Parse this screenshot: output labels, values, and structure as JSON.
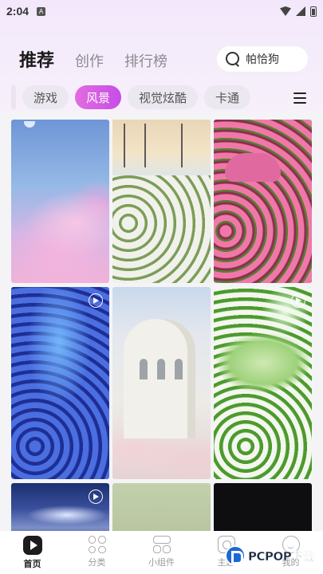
{
  "status_bar": {
    "time": "2:04",
    "notification_badge": "A"
  },
  "top_tabs": [
    {
      "label": "推荐",
      "active": true
    },
    {
      "label": "创作",
      "active": false
    },
    {
      "label": "排行榜",
      "active": false
    }
  ],
  "search": {
    "text": "帕恰狗"
  },
  "chips": [
    {
      "label": "游戏",
      "active": false
    },
    {
      "label": "风景",
      "active": true
    },
    {
      "label": "视觉炫酷",
      "active": false
    },
    {
      "label": "卡通",
      "active": false
    }
  ],
  "grid": {
    "tiles": [
      {
        "subject": "pink clouds sky",
        "video": false
      },
      {
        "subject": "white tulips field",
        "video": false
      },
      {
        "subject": "pink tulips with bear",
        "video": false
      },
      {
        "subject": "blue waterfall roses",
        "video": true
      },
      {
        "subject": "white castle cherry blossom",
        "video": false
      },
      {
        "subject": "green mushroom house",
        "video": true
      },
      {
        "subject": "lightning night clouds",
        "video": true
      },
      {
        "subject": "pale green texture",
        "video": false
      },
      {
        "subject": "black",
        "video": false
      }
    ]
  },
  "bottom_nav": [
    {
      "label": "首页",
      "icon": "home-icon",
      "active": true
    },
    {
      "label": "分类",
      "icon": "category-icon",
      "active": false
    },
    {
      "label": "小组件",
      "icon": "widget-icon",
      "active": false
    },
    {
      "label": "主题",
      "icon": "theme-icon",
      "active": false
    },
    {
      "label": "我的",
      "icon": "profile-icon",
      "active": false
    }
  ],
  "watermark": {
    "text": "PCPOP下载"
  },
  "colors": {
    "accent_start": "#e36be0",
    "accent_end": "#c54ee6",
    "text_dark": "#1a1a1a",
    "text_muted": "#8a8a90"
  }
}
